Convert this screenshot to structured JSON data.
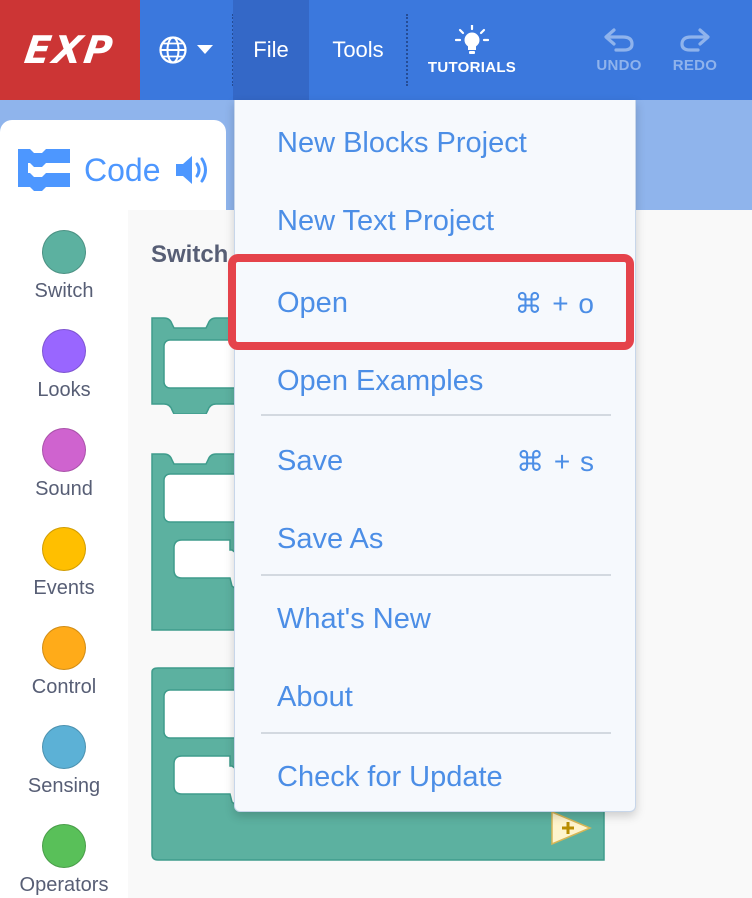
{
  "menubar": {
    "brand": "EXP",
    "language_icon": "globe-icon",
    "file_label": "File",
    "tools_label": "Tools",
    "tutorials_label": "TUTORIALS",
    "undo_label": "UNDO",
    "redo_label": "REDO"
  },
  "code_tab": {
    "label": "Code"
  },
  "palette": {
    "title": "Switch",
    "categories": [
      {
        "label": "Switch",
        "color": "#5cb1a0"
      },
      {
        "label": "Looks",
        "color": "#9966ff"
      },
      {
        "label": "Sound",
        "color": "#cf63cf"
      },
      {
        "label": "Events",
        "color": "#ffbf00"
      },
      {
        "label": "Control",
        "color": "#ffab19"
      },
      {
        "label": "Sensing",
        "color": "#5cb1d6"
      },
      {
        "label": "Operators",
        "color": "#59c059"
      }
    ]
  },
  "file_menu": {
    "items": [
      {
        "label": "New Blocks Project",
        "shortcut": ""
      },
      {
        "label": "New Text Project",
        "shortcut": ""
      },
      {
        "label": "Open",
        "shortcut": "⌘ + o"
      },
      {
        "label": "Open Examples",
        "shortcut": ""
      },
      {
        "label": "Save",
        "shortcut": "⌘ + s"
      },
      {
        "label": "Save As",
        "shortcut": ""
      },
      {
        "label": "What's New",
        "shortcut": ""
      },
      {
        "label": "About",
        "shortcut": ""
      },
      {
        "label": "Check for Update",
        "shortcut": ""
      }
    ]
  },
  "colors": {
    "menubar": "#3b78dd",
    "brand": "#cc3535",
    "menu_text": "#4c8ee6",
    "block": "#5cb1a0",
    "highlight": "#e5434b"
  }
}
